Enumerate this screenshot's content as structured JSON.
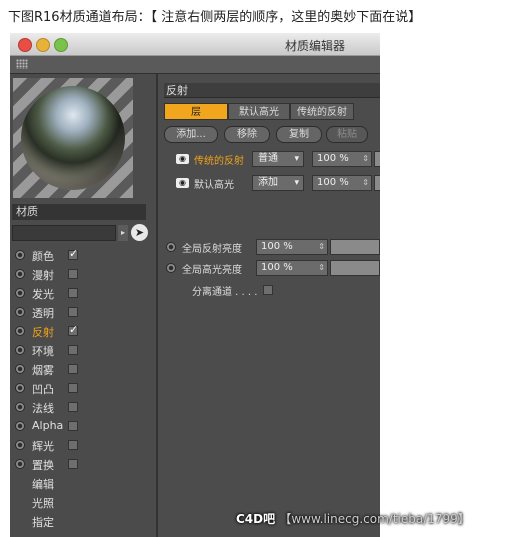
{
  "caption": "下图R16材质通道布局：【 注意右侧两层的顺序，这里的奥妙下面在说】",
  "window": {
    "title": "材质编辑器"
  },
  "left_panel": {
    "material_label": "材质",
    "channels": [
      {
        "label": "颜色",
        "checked": true,
        "has_checkbox": true
      },
      {
        "label": "漫射",
        "checked": false,
        "has_checkbox": true
      },
      {
        "label": "发光",
        "checked": false,
        "has_checkbox": true
      },
      {
        "label": "透明",
        "checked": false,
        "has_checkbox": true
      },
      {
        "label": "反射",
        "checked": true,
        "has_checkbox": true,
        "active": true
      },
      {
        "label": "环境",
        "checked": false,
        "has_checkbox": true
      },
      {
        "label": "烟雾",
        "checked": false,
        "has_checkbox": true
      },
      {
        "label": "凹凸",
        "checked": false,
        "has_checkbox": true
      },
      {
        "label": "法线",
        "checked": false,
        "has_checkbox": true
      },
      {
        "label": "Alpha",
        "checked": false,
        "has_checkbox": true
      },
      {
        "label": "辉光",
        "checked": false,
        "has_checkbox": true
      },
      {
        "label": "置换",
        "checked": false,
        "has_checkbox": true
      },
      {
        "label": "编辑",
        "checked": false,
        "has_checkbox": false
      },
      {
        "label": "光照",
        "checked": false,
        "has_checkbox": false
      },
      {
        "label": "指定",
        "checked": false,
        "has_checkbox": false
      }
    ]
  },
  "right_panel": {
    "section_title": "反射",
    "tabs": [
      "层",
      "默认高光",
      "传统的反射"
    ],
    "buttons": {
      "add": "添加...",
      "remove": "移除",
      "copy": "复制",
      "paste": "粘贴"
    },
    "layers": [
      {
        "name": "传统的反射",
        "blend": "普通",
        "amount": "100 %",
        "active": true
      },
      {
        "name": "默认高光",
        "blend": "添加",
        "amount": "100 %",
        "active": false
      }
    ],
    "global_reflection": {
      "label": "全局反射亮度",
      "value": "100 %"
    },
    "global_specular": {
      "label": "全局高光亮度",
      "value": "100 %"
    },
    "separate_pass": {
      "label": "分离通道 . . . ."
    }
  },
  "watermark": {
    "brand": "C4D吧",
    "url": "【www.linecg.com/tieba/1799】"
  }
}
